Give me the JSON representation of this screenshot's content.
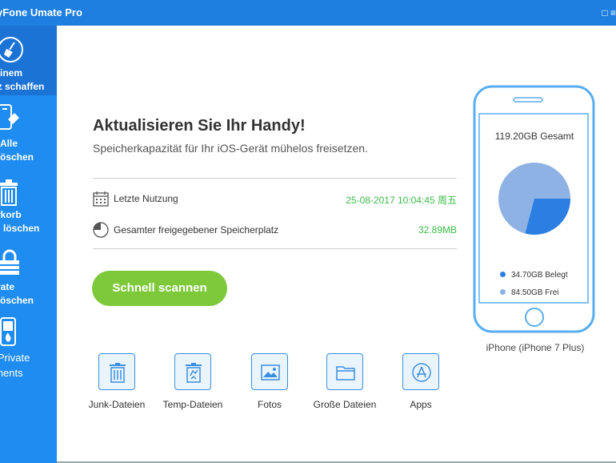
{
  "app": {
    "title": "yFone Umate Pro"
  },
  "sidebar": {
    "items": [
      {
        "line1": ": einem",
        "line2": "atz schaffen",
        "icon": "broom-icon",
        "active": true
      },
      {
        "line1": "Alle",
        "line2": "n löschen",
        "icon": "phone-eraser-icon"
      },
      {
        "line1": "ierkorb",
        "line2": "tig löschen",
        "icon": "trash-icon"
      },
      {
        "line1": "rivate",
        "line2": "n löschen",
        "icon": "lock-icon"
      },
      {
        "line1": "e Private",
        "line2": "gments",
        "icon": "phone-fire-icon"
      }
    ]
  },
  "main": {
    "headline": "Aktualisieren Sie Ihr Handy!",
    "subline": "Speicherkapazität für Ihr iOS-Gerät mühelos freisetzen.",
    "last_use": {
      "label": "Letzte Nutzung",
      "value": "25-08-2017 10:04:45 周五"
    },
    "freed": {
      "label": "Gesamter freigegebener Speicherplatz",
      "value": "32.89MB"
    },
    "scan_button": "Schnell scannen",
    "categories": [
      {
        "label": "Junk-Dateien",
        "icon": "trash-icon"
      },
      {
        "label": "Temp-Dateien",
        "icon": "temp-file-trash-icon"
      },
      {
        "label": "Fotos",
        "icon": "photo-icon"
      },
      {
        "label": "Große Dateien",
        "icon": "folder-icon"
      },
      {
        "label": "Apps",
        "icon": "app-store-icon"
      }
    ]
  },
  "device": {
    "total": "119.20GB Gesamt",
    "used_label": "34.70GB Belegt",
    "free_label": "84.50GB Frei",
    "used_gb": 34.7,
    "free_gb": 84.5,
    "caption": "iPhone (iPhone 7 Plus)",
    "colors": {
      "used": "#2b7fe3",
      "free": "#8eb2e4"
    }
  },
  "colors": {
    "accent": "#1e8cf0",
    "success": "#3dbb4a",
    "button": "#7dc93a"
  }
}
